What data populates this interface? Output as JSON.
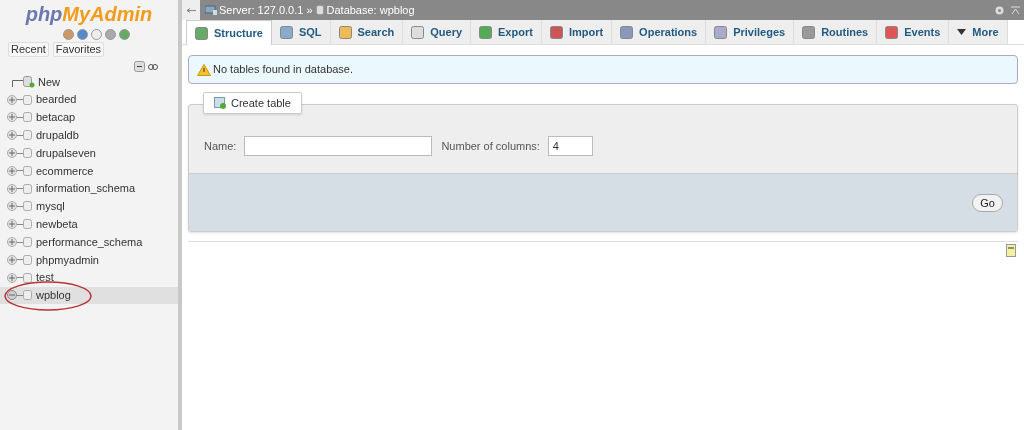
{
  "logo": {
    "prefix": "php",
    "name": "MyAdmin"
  },
  "sidebar_tabs": [
    "Recent",
    "Favorites"
  ],
  "tree": [
    {
      "kind": "new",
      "label": "New",
      "selected": false,
      "annotated": false
    },
    {
      "kind": "database",
      "label": "bearded",
      "expanded": false,
      "selected": false,
      "annotated": false
    },
    {
      "kind": "database",
      "label": "betacap",
      "expanded": false,
      "selected": false,
      "annotated": false
    },
    {
      "kind": "database",
      "label": "drupaldb",
      "expanded": false,
      "selected": false,
      "annotated": false
    },
    {
      "kind": "database",
      "label": "drupalseven",
      "expanded": false,
      "selected": false,
      "annotated": false
    },
    {
      "kind": "database",
      "label": "ecommerce",
      "expanded": false,
      "selected": false,
      "annotated": false
    },
    {
      "kind": "database",
      "label": "information_schema",
      "expanded": false,
      "selected": false,
      "annotated": false
    },
    {
      "kind": "database",
      "label": "mysql",
      "expanded": false,
      "selected": false,
      "annotated": false
    },
    {
      "kind": "database",
      "label": "newbeta",
      "expanded": false,
      "selected": false,
      "annotated": false
    },
    {
      "kind": "database",
      "label": "performance_schema",
      "expanded": false,
      "selected": false,
      "annotated": false
    },
    {
      "kind": "database",
      "label": "phpmyadmin",
      "expanded": false,
      "selected": false,
      "annotated": false
    },
    {
      "kind": "database",
      "label": "test",
      "expanded": false,
      "selected": false,
      "annotated": false
    },
    {
      "kind": "database",
      "label": "wpblog",
      "expanded": true,
      "selected": true,
      "annotated": true
    }
  ],
  "breadcrumb": {
    "server": "Server: 127.0.0.1",
    "separator": "»",
    "database": "Database: wpblog"
  },
  "tabs": [
    {
      "label": "Structure",
      "selected": true
    },
    {
      "label": "SQL",
      "selected": false
    },
    {
      "label": "Search",
      "selected": false
    },
    {
      "label": "Query",
      "selected": false
    },
    {
      "label": "Export",
      "selected": false
    },
    {
      "label": "Import",
      "selected": false
    },
    {
      "label": "Operations",
      "selected": false
    },
    {
      "label": "Privileges",
      "selected": false
    },
    {
      "label": "Routines",
      "selected": false
    },
    {
      "label": "Events",
      "selected": false
    },
    {
      "label": "More",
      "selected": false
    }
  ],
  "notice": "No tables found in database.",
  "create_table": {
    "legend": "Create table",
    "name_label": "Name:",
    "columns_label": "Number of columns:",
    "columns_value": "4",
    "button": "Go"
  }
}
